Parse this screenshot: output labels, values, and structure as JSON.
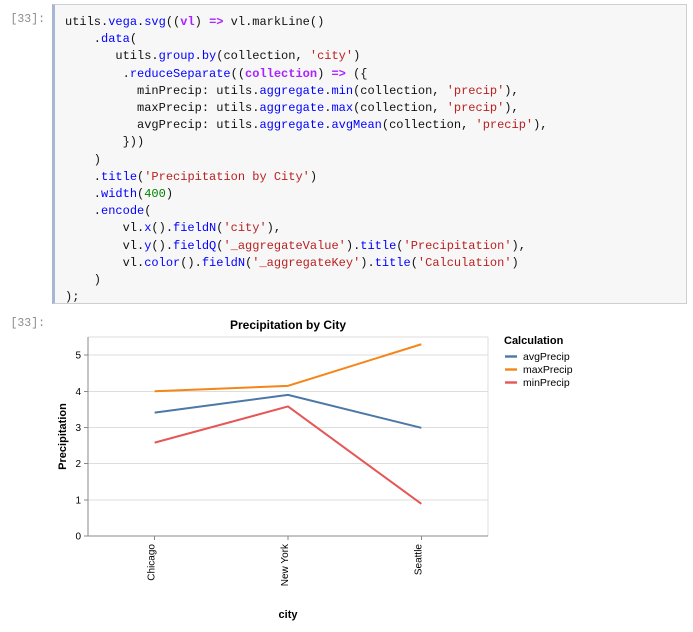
{
  "notebook": {
    "input_prompt": "[33]:",
    "output_prompt": "[33]:",
    "code_lines": [
      [
        {
          "t": "utils.",
          "c": "plain"
        },
        {
          "t": "vega",
          "c": "fn"
        },
        {
          "t": ".",
          "c": "plain"
        },
        {
          "t": "svg",
          "c": "fn"
        },
        {
          "t": "((",
          "c": "plain"
        },
        {
          "t": "vl",
          "c": "op"
        },
        {
          "t": ") ",
          "c": "plain"
        },
        {
          "t": "=>",
          "c": "op"
        },
        {
          "t": " vl.markLine()",
          "c": "plain"
        }
      ],
      [
        {
          "t": "    .",
          "c": "plain"
        },
        {
          "t": "data",
          "c": "fn"
        },
        {
          "t": "(",
          "c": "plain"
        }
      ],
      [
        {
          "t": "       utils.",
          "c": "plain"
        },
        {
          "t": "group",
          "c": "fn"
        },
        {
          "t": ".",
          "c": "plain"
        },
        {
          "t": "by",
          "c": "fn"
        },
        {
          "t": "(collection, ",
          "c": "plain"
        },
        {
          "t": "'city'",
          "c": "str"
        },
        {
          "t": ")",
          "c": "plain"
        }
      ],
      [
        {
          "t": "        .",
          "c": "plain"
        },
        {
          "t": "reduceSeparate",
          "c": "fn"
        },
        {
          "t": "((",
          "c": "plain"
        },
        {
          "t": "collection",
          "c": "op"
        },
        {
          "t": ") ",
          "c": "plain"
        },
        {
          "t": "=>",
          "c": "op"
        },
        {
          "t": " ({",
          "c": "plain"
        }
      ],
      [
        {
          "t": "          minPrecip: utils.",
          "c": "plain"
        },
        {
          "t": "aggregate",
          "c": "fn"
        },
        {
          "t": ".",
          "c": "plain"
        },
        {
          "t": "min",
          "c": "fn"
        },
        {
          "t": "(collection, ",
          "c": "plain"
        },
        {
          "t": "'precip'",
          "c": "str"
        },
        {
          "t": "),",
          "c": "plain"
        }
      ],
      [
        {
          "t": "          maxPrecip: utils.",
          "c": "plain"
        },
        {
          "t": "aggregate",
          "c": "fn"
        },
        {
          "t": ".",
          "c": "plain"
        },
        {
          "t": "max",
          "c": "fn"
        },
        {
          "t": "(collection, ",
          "c": "plain"
        },
        {
          "t": "'precip'",
          "c": "str"
        },
        {
          "t": "),",
          "c": "plain"
        }
      ],
      [
        {
          "t": "          avgPrecip: utils.",
          "c": "plain"
        },
        {
          "t": "aggregate",
          "c": "fn"
        },
        {
          "t": ".",
          "c": "plain"
        },
        {
          "t": "avgMean",
          "c": "fn"
        },
        {
          "t": "(collection, ",
          "c": "plain"
        },
        {
          "t": "'precip'",
          "c": "str"
        },
        {
          "t": "),",
          "c": "plain"
        }
      ],
      [
        {
          "t": "        }))",
          "c": "plain"
        }
      ],
      [
        {
          "t": "    )",
          "c": "plain"
        }
      ],
      [
        {
          "t": "    .",
          "c": "plain"
        },
        {
          "t": "title",
          "c": "fn"
        },
        {
          "t": "(",
          "c": "plain"
        },
        {
          "t": "'Precipitation by City'",
          "c": "str"
        },
        {
          "t": ")",
          "c": "plain"
        }
      ],
      [
        {
          "t": "    .",
          "c": "plain"
        },
        {
          "t": "width",
          "c": "fn"
        },
        {
          "t": "(",
          "c": "plain"
        },
        {
          "t": "400",
          "c": "num"
        },
        {
          "t": ")",
          "c": "plain"
        }
      ],
      [
        {
          "t": "    .",
          "c": "plain"
        },
        {
          "t": "encode",
          "c": "fn"
        },
        {
          "t": "(",
          "c": "plain"
        }
      ],
      [
        {
          "t": "        vl.",
          "c": "plain"
        },
        {
          "t": "x",
          "c": "fn"
        },
        {
          "t": "().",
          "c": "plain"
        },
        {
          "t": "fieldN",
          "c": "fn"
        },
        {
          "t": "(",
          "c": "plain"
        },
        {
          "t": "'city'",
          "c": "str"
        },
        {
          "t": "),",
          "c": "plain"
        }
      ],
      [
        {
          "t": "        vl.",
          "c": "plain"
        },
        {
          "t": "y",
          "c": "fn"
        },
        {
          "t": "().",
          "c": "plain"
        },
        {
          "t": "fieldQ",
          "c": "fn"
        },
        {
          "t": "(",
          "c": "plain"
        },
        {
          "t": "'_aggregateValue'",
          "c": "str"
        },
        {
          "t": ").",
          "c": "plain"
        },
        {
          "t": "title",
          "c": "fn"
        },
        {
          "t": "(",
          "c": "plain"
        },
        {
          "t": "'Precipitation'",
          "c": "str"
        },
        {
          "t": "),",
          "c": "plain"
        }
      ],
      [
        {
          "t": "        vl.",
          "c": "plain"
        },
        {
          "t": "color",
          "c": "fn"
        },
        {
          "t": "().",
          "c": "plain"
        },
        {
          "t": "fieldN",
          "c": "fn"
        },
        {
          "t": "(",
          "c": "plain"
        },
        {
          "t": "'_aggregateKey'",
          "c": "str"
        },
        {
          "t": ").",
          "c": "plain"
        },
        {
          "t": "title",
          "c": "fn"
        },
        {
          "t": "(",
          "c": "plain"
        },
        {
          "t": "'Calculation'",
          "c": "str"
        },
        {
          "t": ")",
          "c": "plain"
        }
      ],
      [
        {
          "t": "    )",
          "c": "plain"
        }
      ],
      [
        {
          "t": ");",
          "c": "plain"
        }
      ]
    ]
  },
  "chart_data": {
    "type": "line",
    "title": "Precipitation by City",
    "xlabel": "city",
    "ylabel": "Precipitation",
    "categories": [
      "Chicago",
      "New York",
      "Seattle"
    ],
    "ylim": [
      0,
      5.5
    ],
    "yticks": [
      0,
      1,
      2,
      3,
      4,
      5
    ],
    "grid": true,
    "legend": {
      "title": "Calculation",
      "position": "right",
      "entries": [
        {
          "name": "avgPrecip",
          "color": "#4c78a8"
        },
        {
          "name": "maxPrecip",
          "color": "#f58518"
        },
        {
          "name": "minPrecip",
          "color": "#e45756"
        }
      ]
    },
    "series": [
      {
        "name": "avgPrecip",
        "color": "#4c78a8",
        "values": [
          3.41,
          3.9,
          2.99
        ]
      },
      {
        "name": "maxPrecip",
        "color": "#f58518",
        "values": [
          4.0,
          4.15,
          5.3
        ]
      },
      {
        "name": "minPrecip",
        "color": "#e45756",
        "values": [
          2.58,
          3.58,
          0.89
        ]
      }
    ]
  }
}
